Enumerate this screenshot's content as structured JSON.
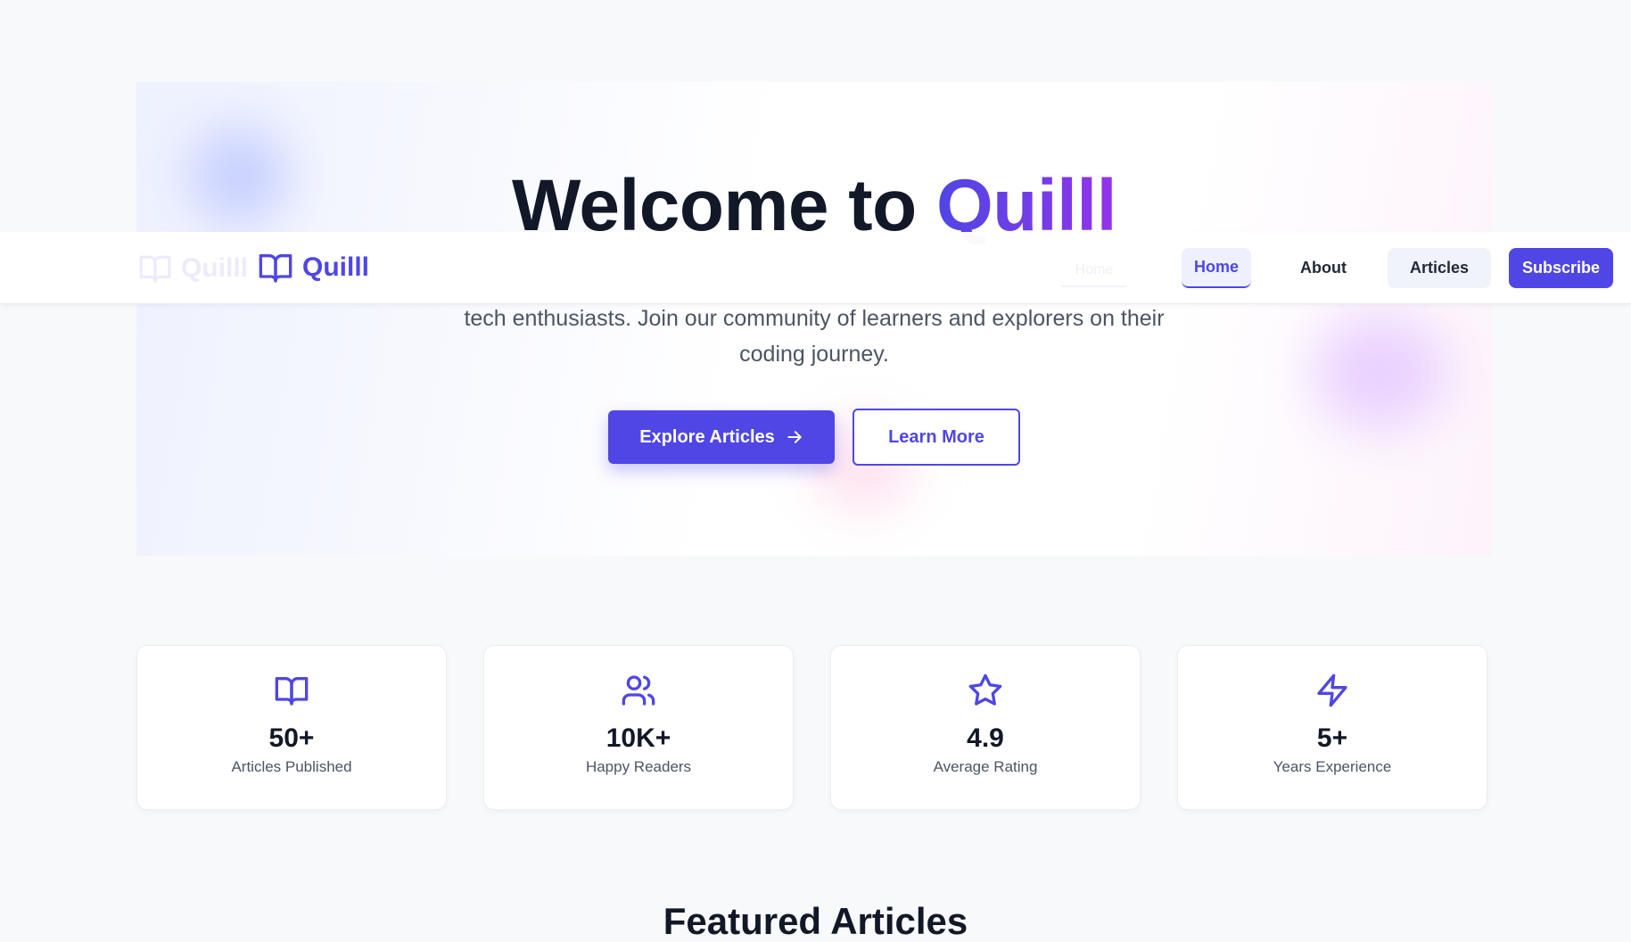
{
  "brand": {
    "name": "Quilll",
    "logo_icon": "book-open-icon",
    "accent_color": "#4f46e5",
    "gradient_end": "#9333ea"
  },
  "navbar": {
    "items": [
      {
        "label": "Home",
        "active": true
      },
      {
        "label": "About",
        "active": false
      },
      {
        "label": "Articles",
        "active": false
      }
    ],
    "subscribe_label": "Subscribe"
  },
  "hero": {
    "title_prefix": "Welcome to",
    "title_brand": "Quilll",
    "description": "tech enthusiasts. Join our community of learners and explorers on their coding journey.",
    "primary_button": "Explore Articles",
    "secondary_button": "Learn More"
  },
  "stats": [
    {
      "icon": "book-open-icon",
      "value": "50+",
      "label": "Articles Published"
    },
    {
      "icon": "users-icon",
      "value": "10K+",
      "label": "Happy Readers"
    },
    {
      "icon": "star-icon",
      "value": "4.9",
      "label": "Average Rating"
    },
    {
      "icon": "lightning-icon",
      "value": "5+",
      "label": "Years Experience"
    }
  ],
  "featured": {
    "title": "Featured Articles"
  }
}
